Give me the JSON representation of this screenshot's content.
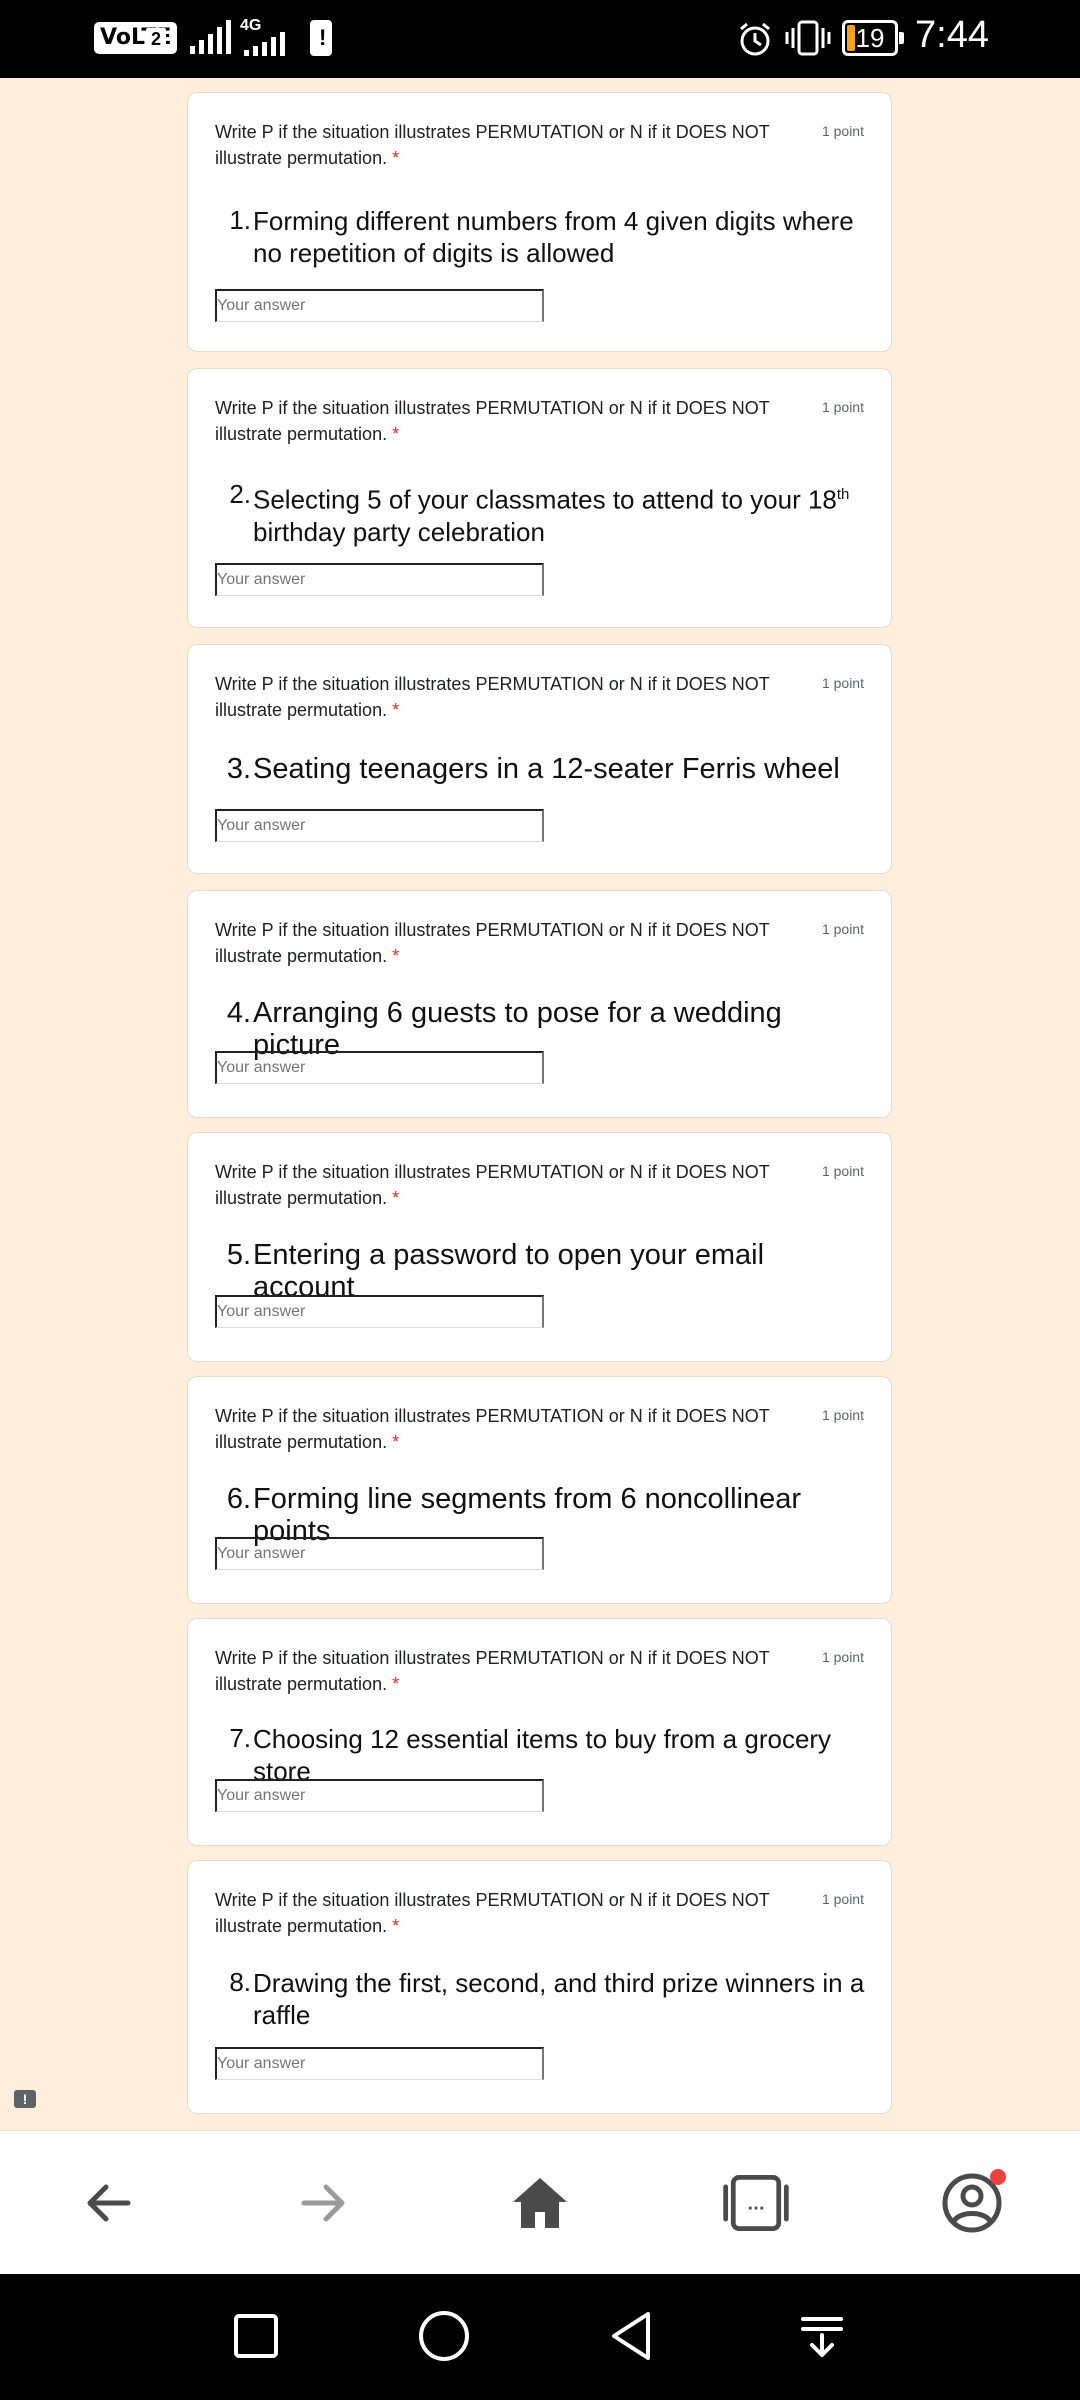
{
  "status_bar": {
    "network_badge": "VoLTE",
    "sim_slot": "2",
    "network_type": "4G",
    "battery_level": "19",
    "time": "7:44"
  },
  "form": {
    "instruction": "Write P if the situation illustrates PERMUTATION or N if it DOES NOT illustrate permutation.",
    "required_mark": "*",
    "points_label": "1 point",
    "answer_placeholder": "Your answer",
    "questions": [
      {
        "number": "1.",
        "text": "Forming different numbers from 4 given digits where no repetition of digits is allowed",
        "suffix": ""
      },
      {
        "number": "2.",
        "text": "Selecting 5 of your classmates to attend to your 18",
        "sup": "th",
        "suffix": " birthday party celebration"
      },
      {
        "number": "3.",
        "text": "Seating teenagers in a 12-seater Ferris wheel",
        "suffix": ""
      },
      {
        "number": "4.",
        "text": "Arranging 6 guests to pose for a wedding picture",
        "suffix": ""
      },
      {
        "number": "5.",
        "text": "Entering a password to open your email account",
        "suffix": ""
      },
      {
        "number": "6.",
        "text": "Forming line segments from 6 noncollinear points",
        "suffix": ""
      },
      {
        "number": "7.",
        "text": "Choosing 12 essential items to buy from a grocery store",
        "suffix": ""
      },
      {
        "number": "8.",
        "text": "Drawing the first, second, and third prize winners in a raffle",
        "suffix": ""
      }
    ]
  },
  "feedback_icon": "report-icon",
  "browser_bar": {
    "icons": [
      "back-arrow-icon",
      "forward-arrow-icon",
      "home-icon",
      "tabs-icon",
      "account-icon"
    ],
    "notification_color": "#ef4040"
  },
  "nav_bar": {
    "icons": [
      "recents-square-icon",
      "home-circle-icon",
      "back-triangle-icon",
      "notification-pulldown-icon"
    ]
  },
  "colors": {
    "page_background": "#fdefdb",
    "required": "#d93025"
  }
}
